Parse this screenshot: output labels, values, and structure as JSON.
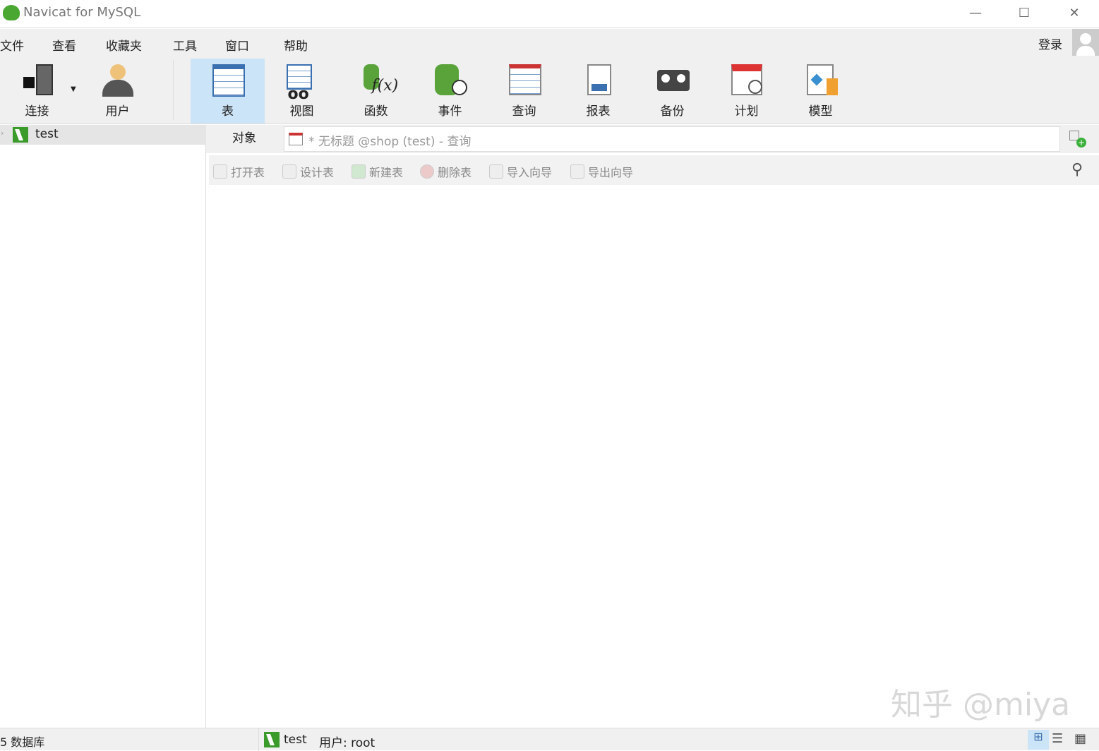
{
  "window": {
    "title": "Navicat for MySQL"
  },
  "menu": [
    "文件",
    "查看",
    "收藏夹",
    "工具",
    "窗口",
    "帮助"
  ],
  "login": "登录",
  "toolbar": [
    {
      "label": "连接",
      "icon": "connection-icon"
    },
    {
      "label": "用户",
      "icon": "user-icon"
    },
    {
      "label": "表",
      "icon": "table-icon"
    },
    {
      "label": "视图",
      "icon": "view-icon"
    },
    {
      "label": "函数",
      "icon": "function-icon"
    },
    {
      "label": "事件",
      "icon": "event-icon"
    },
    {
      "label": "查询",
      "icon": "query-icon"
    },
    {
      "label": "报表",
      "icon": "report-icon"
    },
    {
      "label": "备份",
      "icon": "backup-icon"
    },
    {
      "label": "计划",
      "icon": "schedule-icon"
    },
    {
      "label": "模型",
      "icon": "model-icon"
    }
  ],
  "sidebar": {
    "connection": "test"
  },
  "tabs": {
    "objects": "对象",
    "query": "* 无标题 @shop (test) - 查询"
  },
  "object_toolbar": [
    "打开表",
    "设计表",
    "新建表",
    "删除表",
    "导入向导",
    "导出向导"
  ],
  "status": {
    "databases": "5 数据库",
    "connection": "test",
    "user": "用户: root"
  },
  "watermark": "知乎 @miya"
}
